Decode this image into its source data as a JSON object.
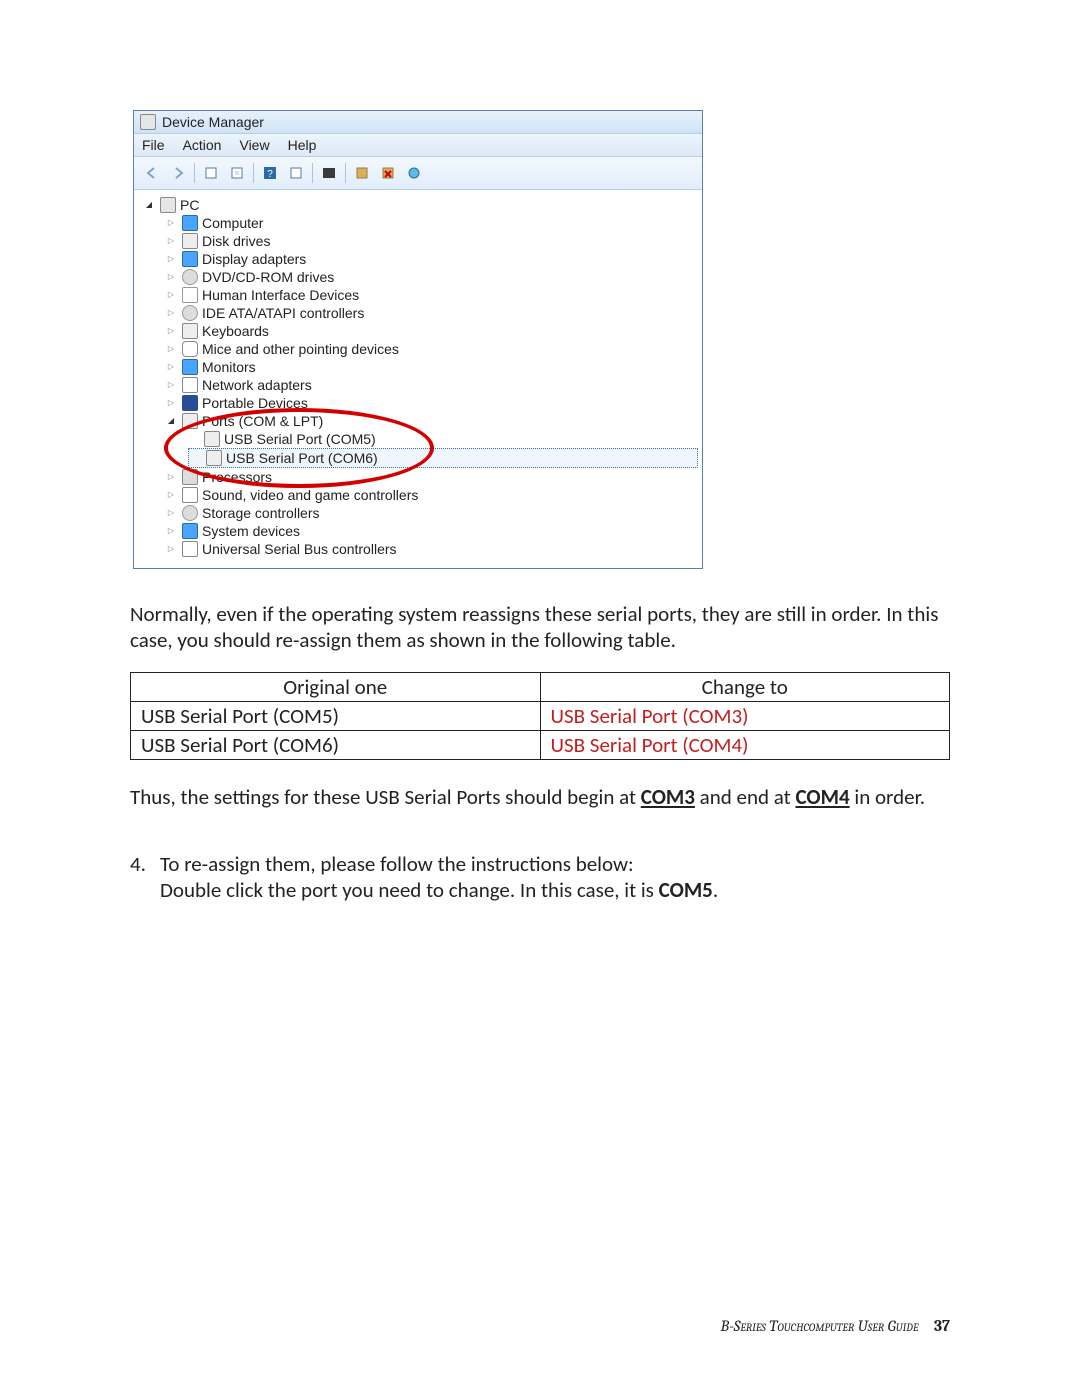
{
  "device_manager": {
    "title": "Device Manager",
    "menus": [
      "File",
      "Action",
      "View",
      "Help"
    ],
    "root": "PC",
    "items": [
      {
        "label": "Computer",
        "icon": "mon"
      },
      {
        "label": "Disk drives",
        "icon": "disk"
      },
      {
        "label": "Display adapters",
        "icon": "mon"
      },
      {
        "label": "DVD/CD-ROM drives",
        "icon": "drive"
      },
      {
        "label": "Human Interface Devices",
        "icon": "hid"
      },
      {
        "label": "IDE ATA/ATAPI controllers",
        "icon": "drive"
      },
      {
        "label": "Keyboards",
        "icon": "kb"
      },
      {
        "label": "Mice and other pointing devices",
        "icon": "mouse"
      },
      {
        "label": "Monitors",
        "icon": "mon"
      },
      {
        "label": "Network adapters",
        "icon": "net"
      },
      {
        "label": "Portable Devices",
        "icon": "blue"
      },
      {
        "label": "Ports (COM & LPT)",
        "icon": "port",
        "open": true,
        "children": [
          {
            "label": "USB Serial Port (COM5)",
            "icon": "port"
          },
          {
            "label": "USB Serial Port (COM6)",
            "icon": "port",
            "selected": true
          }
        ]
      },
      {
        "label": "Processors",
        "icon": "chip"
      },
      {
        "label": "Sound, video and game controllers",
        "icon": "snd"
      },
      {
        "label": "Storage controllers",
        "icon": "drive"
      },
      {
        "label": "System devices",
        "icon": "mon"
      },
      {
        "label": "Universal Serial Bus controllers",
        "icon": "usb"
      }
    ]
  },
  "para1": "Normally, even if the operating system reassigns these serial ports, they are still in order. In this case, you should re-assign them as shown in the following table.",
  "table": {
    "headers": [
      "Original one",
      "Change to"
    ],
    "rows": [
      [
        "USB Serial Port (COM5)",
        "USB Serial Port (COM3)"
      ],
      [
        "USB Serial Port (COM6)",
        "USB Serial Port (COM4)"
      ]
    ]
  },
  "para2_a": "Thus, the settings for these USB Serial Ports should begin at ",
  "para2_b": "COM3",
  "para2_c": " and end at ",
  "para2_d": "COM4",
  "para2_e": " in order.",
  "step_num": "4.",
  "step_a": "To re-assign them, please follow the instructions below:",
  "step_b_a": "Double click the port you need to change. In this case, it is ",
  "step_b_b": "COM5",
  "step_b_c": ".",
  "footer_title": "B-Series Touchcomputer User Guide",
  "footer_page": "37"
}
